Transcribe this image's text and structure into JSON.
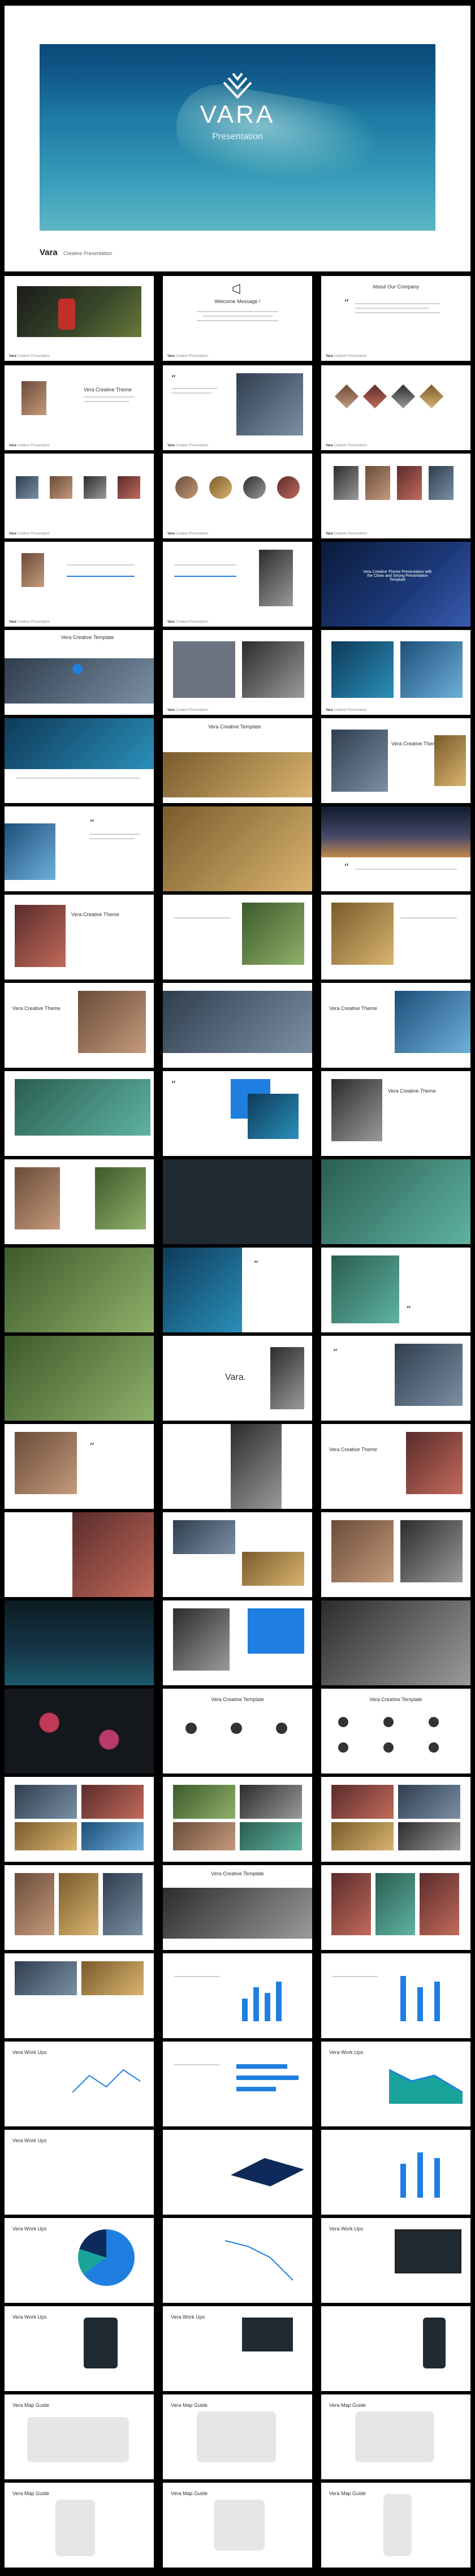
{
  "hero": {
    "title": "VARA",
    "subtitle": "Presentation",
    "caption_brand": "Vara",
    "caption_text": "Creative Presentation"
  },
  "slides": {
    "welcome_title": "Welcome Message !",
    "about_title": "About Our Company",
    "theme_title": "Vera Creative Theme",
    "template_title": "Vera Creative Template",
    "works_title": "Vera Work Ups",
    "map_title": "Vera Map Guide",
    "logo_text": "Vara.",
    "footer_brand": "Vara",
    "footer_text": "Creative Presentation",
    "banner_text": "Vera Creative Theme Presentation with the Clean and Strong Presentation Template"
  },
  "colors": {
    "background": "#000000",
    "accent": "#1e7fe0",
    "teal": "#1aa39a"
  }
}
